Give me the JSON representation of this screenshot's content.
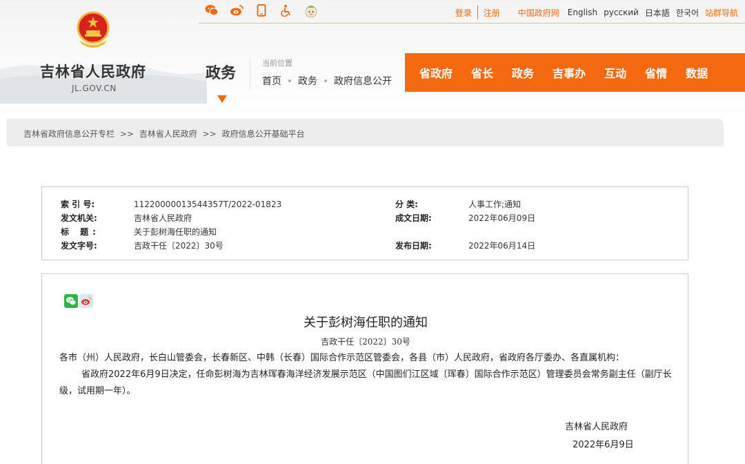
{
  "header": {
    "site_name": "吉林省人民政府",
    "site_domain": "JL.GOV.CN",
    "section_title": "政务",
    "current_position_label": "当前位置",
    "current_position": [
      "首页",
      "政务",
      "政府信息公开"
    ],
    "icons": [
      "weibo-like-orange-icon",
      "weibo-icon",
      "mobile-icon",
      "accessibility-icon",
      "mascot-icon"
    ],
    "top_links": {
      "login": "登录",
      "register": "注册",
      "gov_site": "中国政府网",
      "english": "English",
      "russian": "русский",
      "japanese": "日本語",
      "korean": "한국어",
      "site_nav": "站群导航"
    },
    "main_nav": [
      "省政府",
      "省长",
      "政务",
      "吉事办",
      "互动",
      "省情",
      "数据"
    ],
    "accent_color": "#f56a10"
  },
  "breadcrumb": {
    "items": [
      "吉林省政府信息公开专栏",
      "吉林省人民政府",
      "政府信息公开基础平台"
    ],
    "separator": ">>"
  },
  "info": {
    "index_label": "索 引 号:",
    "index_value": "11220000013544357T/2022-01823",
    "category_label": "分 类:",
    "category_value": "人事工作;通知",
    "issuer_label": "发文机关:",
    "issuer_value": "吉林省人民政府",
    "date_label": "成文日期:",
    "date_value": "2022年06月09日",
    "title_label": "标 题:",
    "title_value": "关于彭树海任职的通知",
    "docno_label": "发文字号:",
    "docno_value": "吉政干任〔2022〕30号",
    "publish_label": "发布日期:",
    "publish_value": "2022年06月14日"
  },
  "article": {
    "share_icons": [
      "wechat-icon",
      "weibo-icon"
    ],
    "title": "关于彭树海任职的通知",
    "doc_number": "吉政干任〔2022〕30号",
    "paragraph1": "各市（州）人民政府，长白山管委会，长春新区、中韩（长春）国际合作示范区管委会，各县（市）人民政府，省政府各厅委办、各直属机构：",
    "paragraph2": "省政府2022年6月9日决定，任命彭树海为吉林珲春海洋经济发展示范区（中国图们江区域〔珲春〕国际合作示范区）管理委员会常务副主任（副厅长级，试用期一年）。",
    "signature": "吉林省人民政府",
    "signature_date": "2022年6月9日"
  }
}
